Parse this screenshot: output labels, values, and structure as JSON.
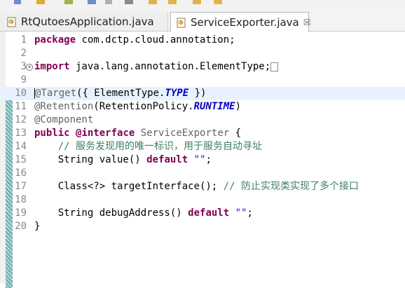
{
  "tabs": [
    {
      "label": "RtQutoesApplication.java",
      "active": false
    },
    {
      "label": "ServiceExporter.java",
      "active": true,
      "close": "☒"
    }
  ],
  "editor": {
    "lines": [
      {
        "num": "1",
        "tokens": [
          {
            "t": "package",
            "c": "kw"
          },
          {
            "t": " com.dctp.cloud.annotation;",
            "c": ""
          }
        ]
      },
      {
        "num": "2",
        "tokens": []
      },
      {
        "num": "3",
        "fold": "+",
        "tokens": [
          {
            "t": "import",
            "c": "kw"
          },
          {
            "t": " java.lang.annotation.ElementType;",
            "c": ""
          }
        ],
        "collapsed": true
      },
      {
        "num": "9",
        "tokens": []
      },
      {
        "num": "10",
        "caret": true,
        "tokens": [
          {
            "t": "@Target",
            "c": "ann"
          },
          {
            "t": "({ ElementType.",
            "c": ""
          },
          {
            "t": "TYPE",
            "c": "field"
          },
          {
            "t": " })",
            "c": ""
          }
        ]
      },
      {
        "num": "11",
        "tokens": [
          {
            "t": "@Retention",
            "c": "ann"
          },
          {
            "t": "(RetentionPolicy.",
            "c": ""
          },
          {
            "t": "RUNTIME",
            "c": "field"
          },
          {
            "t": ")",
            "c": ""
          }
        ]
      },
      {
        "num": "12",
        "tokens": [
          {
            "t": "@Component",
            "c": "ann"
          }
        ]
      },
      {
        "num": "13",
        "tokens": [
          {
            "t": "public",
            "c": "kw"
          },
          {
            "t": " ",
            "c": ""
          },
          {
            "t": "@interface",
            "c": "kw"
          },
          {
            "t": " ",
            "c": ""
          },
          {
            "t": "ServiceExporter",
            "c": "ann"
          },
          {
            "t": " {",
            "c": ""
          }
        ]
      },
      {
        "num": "14",
        "tokens": [
          {
            "t": "    // 服务发现用的唯一标识，用于服务自动寻址",
            "c": "cmt"
          }
        ]
      },
      {
        "num": "15",
        "tokens": [
          {
            "t": "    String value() ",
            "c": ""
          },
          {
            "t": "default",
            "c": "kw"
          },
          {
            "t": " ",
            "c": ""
          },
          {
            "t": "\"\"",
            "c": "str"
          },
          {
            "t": ";",
            "c": ""
          }
        ]
      },
      {
        "num": "16",
        "tokens": []
      },
      {
        "num": "17",
        "tokens": [
          {
            "t": "    Class<?> targetInterface(); ",
            "c": ""
          },
          {
            "t": "// 防止实现类实现了多个接口",
            "c": "cmt"
          }
        ]
      },
      {
        "num": "18",
        "tokens": []
      },
      {
        "num": "19",
        "tokens": [
          {
            "t": "    String debugAddress() ",
            "c": ""
          },
          {
            "t": "default",
            "c": "kw"
          },
          {
            "t": " ",
            "c": ""
          },
          {
            "t": "\"\"",
            "c": "str"
          },
          {
            "t": ";",
            "c": ""
          }
        ]
      },
      {
        "num": "20",
        "tokens": [
          {
            "t": "}",
            "c": ""
          }
        ]
      }
    ]
  }
}
